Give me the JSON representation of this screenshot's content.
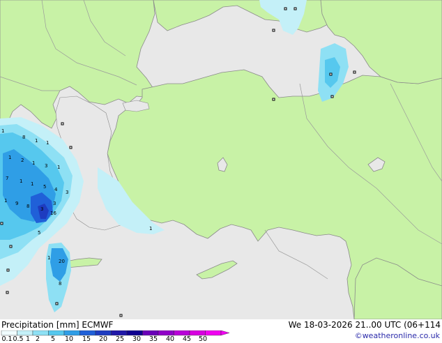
{
  "map": {
    "colors": {
      "sea": "#e8e8e8",
      "land_model": "#c8f2a6",
      "coast": "#a0a0a0",
      "border": "#9a9a9a",
      "precip": [
        "#c4f0f8",
        "#8ee0f4",
        "#56c8ee",
        "#2f9ee6",
        "#2060d8",
        "#1e3cc0",
        "#2018a8",
        "#3a00a0"
      ]
    },
    "value_labels": [
      "1",
      "8",
      "1",
      "1",
      "1",
      "2",
      "1",
      "3",
      "1",
      "7",
      "1",
      "1",
      "5",
      "4",
      "3",
      "1",
      "9",
      "8",
      "3",
      "3",
      "16",
      "5",
      "1",
      "20",
      "8",
      "1"
    ]
  },
  "footer": {
    "left_title": "Precipitation [mm]  ECMWF",
    "right_title": "We 18-03-2026 21..00 UTC (06+114",
    "credit": "©weatheronline.co.uk",
    "scale_labels": [
      "0.1",
      "0.5",
      "1",
      "2",
      "5",
      "10",
      "15",
      "20",
      "25",
      "30",
      "35",
      "40",
      "45",
      "50"
    ],
    "scale_colors": [
      "#f0fcfe",
      "#c4f0f8",
      "#8ee0f4",
      "#56c8ee",
      "#2f9ee6",
      "#2060d8",
      "#1e3cc0",
      "#2018a8",
      "#100090",
      "#6a00b8",
      "#9000c8",
      "#b800d8",
      "#d800e0",
      "#f000f0"
    ]
  }
}
